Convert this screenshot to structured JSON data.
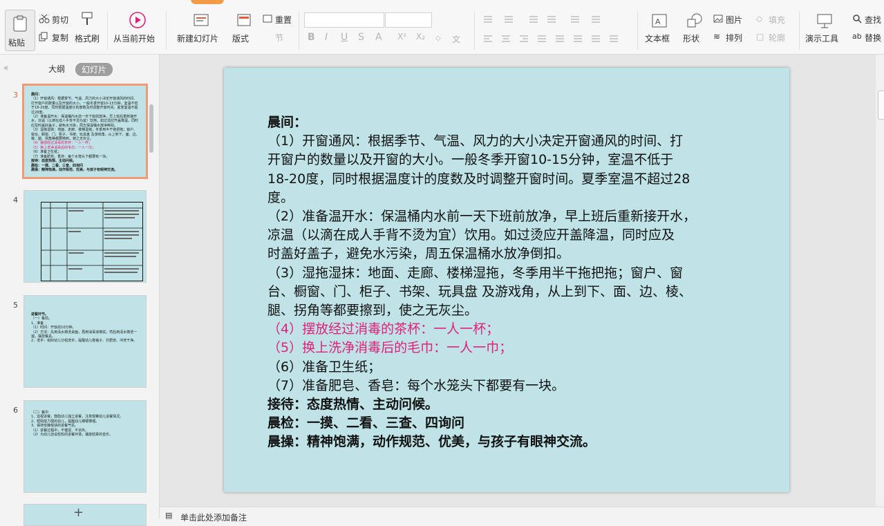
{
  "ribbon": {
    "paste": "粘贴",
    "cut": "剪切",
    "copy": "复制",
    "format_painter": "格式刷",
    "from_current": "从当前开始",
    "new_slide": "新建幻灯片",
    "layout": "版式",
    "reset": "重置",
    "section": "节",
    "bold": "B",
    "italic": "I",
    "underline": "U",
    "strike": "S",
    "font_color": "A",
    "super": "X²",
    "sub": "X₂",
    "pinyin": "文",
    "text_box": "文本框",
    "shape": "形状",
    "picture": "图片",
    "fill": "填充",
    "arrange": "排列",
    "outline": "轮廓",
    "presenter_tools": "演示工具",
    "find": "查找",
    "replace": "替换"
  },
  "panel": {
    "tab_outline": "大纲",
    "tab_slides": "幻灯片",
    "slides": [
      {
        "num": "3"
      },
      {
        "num": "4"
      },
      {
        "num": "5"
      },
      {
        "num": "6"
      }
    ]
  },
  "thumb3": {
    "l1": "晨间：",
    "l2": "（1）开窗通风：根据季节、气温、风力的大小决定开窗通风的时间、打开窗户的数量以及开窗的大小。一般冬季开窗10-15分钟，室温不低于18-20度，同时根据温度计的度数及时调整开窗时间。夏季室温不超过28度。",
    "l3": "（2）准备温开水：保温桶内水前一天下班前放净，早上班后重新接开水，凉温（以滴在成人手背不烫为宜）饮用。如过烫应开盖降温，同时应及时盖好盖子，避免水污染，周五保温桶水放净倒扣。",
    "l4": "（3）湿拖湿抹：地面、走廊、楼梯湿拖，冬季用半干拖把拖；窗户、窗台、橱窗、门、柜子、书架、玩具盘 及游戏角，从上到下、面、边、棱、腿、拐角等都要擦到，使之无灰尘。",
    "l5": "（4）摆放经过消毒的茶杯：一人一杯；",
    "l6": "（5）换上洗净消毒后的毛巾：一人一巾；",
    "l7": "（6）准备卫生纸；",
    "l8": "（7）准备肥皂、香皂：每个水笼头下都要有一块。",
    "l9": "接待：态度热情、主动问候。",
    "l10": "晨检：一摸、二看、三查、四询问",
    "l11": "晨操：精神饱满，动作规范、优美，与孩子有眼神交流。"
  },
  "thumb5": {
    "l1": "进餐环节。",
    "l2": "（一）餐前。",
    "l3": "1、准备",
    "l4": "（1）时间：开饭前10分钟。",
    "l5": "（2）方法：先用清水擦洗桌面，再用消毒液擦拭，然后用清水擦洗一遍，摆放餐具。",
    "l6": "2、洗手：组织幼儿分组洗手，提醒幼儿卷袖子、打肥皂、冲洗干净。"
  },
  "thumb6": {
    "l1": "（二）餐中",
    "l2": "1、巡视进餐，鼓励幼儿独立进餐，注意观察幼儿进餐情况。",
    "l3": "2、帮助能力弱的幼儿，提醒幼儿细嚼慢咽。",
    "l4": "3、保持安静愉快的进餐气氛。",
    "l5": "（1）进餐过程中，不催促、不训斥。",
    "l6": "（2）为幼儿创设轻松的进餐环境，播放轻柔的音乐。"
  },
  "slide": {
    "line1": "晨间：",
    "line2": "（1）开窗通风：根据季节、气温、风力的大小决定开窗通风的时间、打",
    "line3": "开窗户的数量以及开窗的大小。一般冬季开窗10-15分钟，室温不低于",
    "line4": "18-20度，同时根据温度计的度数及时调整开窗时间。夏季室温不超过28",
    "line5": "度。",
    "line6": "（2）准备温开水：保温桶内水前一天下班前放净，早上班后重新接开水，",
    "line7": "凉温（以滴在成人手背不烫为宜）饮用。如过烫应开盖降温，同时应及",
    "line8": "时盖好盖子，避免水污染，周五保温桶水放净倒扣。",
    "line9": "（3）湿拖湿抹：地面、走廊、楼梯湿拖，冬季用半干拖把拖；窗户、窗",
    "line10": "台、橱窗、门、柜子、书架、玩具盘 及游戏角，从上到下、面、边、棱、",
    "line11": "腿、拐角等都要擦到，使之无灰尘。",
    "line12": "（4）摆放经过消毒的茶杯：一人一杯；",
    "line13": "（5）换上洗净消毒后的毛巾：一人一巾；",
    "line14": "（6）准备卫生纸；",
    "line15": "（7）准备肥皂、香皂：每个水笼头下都要有一块。",
    "line16": "接待：态度热情、主动问候。",
    "line17": "晨检：一摸、二看、三查、四询问",
    "line18": "晨操：精神饱满，动作规范、优美，与孩子有眼神交流。"
  },
  "notes": {
    "placeholder": "单击此处添加备注"
  },
  "colors": {
    "slide_bg": "#bfe3e7",
    "accent_red": "#e0207a",
    "selection": "#f39a75"
  }
}
